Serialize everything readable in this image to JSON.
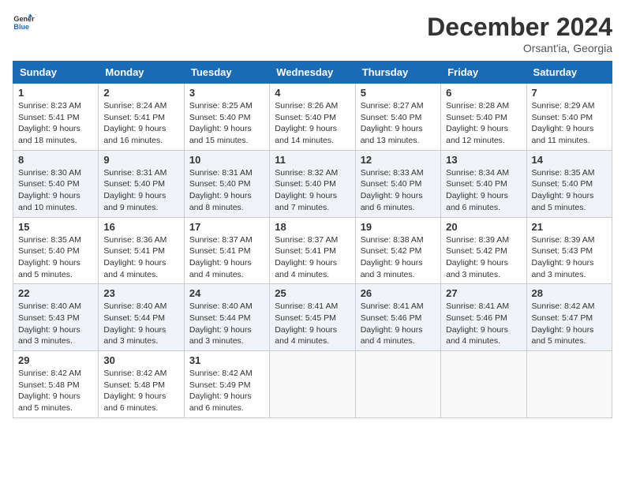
{
  "header": {
    "logo_line1": "General",
    "logo_line2": "Blue",
    "month": "December 2024",
    "location": "Orsant'ia, Georgia"
  },
  "weekdays": [
    "Sunday",
    "Monday",
    "Tuesday",
    "Wednesday",
    "Thursday",
    "Friday",
    "Saturday"
  ],
  "weeks": [
    [
      {
        "day": "1",
        "sunrise": "8:23 AM",
        "sunset": "5:41 PM",
        "daylight": "9 hours and 18 minutes."
      },
      {
        "day": "2",
        "sunrise": "8:24 AM",
        "sunset": "5:41 PM",
        "daylight": "9 hours and 16 minutes."
      },
      {
        "day": "3",
        "sunrise": "8:25 AM",
        "sunset": "5:40 PM",
        "daylight": "9 hours and 15 minutes."
      },
      {
        "day": "4",
        "sunrise": "8:26 AM",
        "sunset": "5:40 PM",
        "daylight": "9 hours and 14 minutes."
      },
      {
        "day": "5",
        "sunrise": "8:27 AM",
        "sunset": "5:40 PM",
        "daylight": "9 hours and 13 minutes."
      },
      {
        "day": "6",
        "sunrise": "8:28 AM",
        "sunset": "5:40 PM",
        "daylight": "9 hours and 12 minutes."
      },
      {
        "day": "7",
        "sunrise": "8:29 AM",
        "sunset": "5:40 PM",
        "daylight": "9 hours and 11 minutes."
      }
    ],
    [
      {
        "day": "8",
        "sunrise": "8:30 AM",
        "sunset": "5:40 PM",
        "daylight": "9 hours and 10 minutes."
      },
      {
        "day": "9",
        "sunrise": "8:31 AM",
        "sunset": "5:40 PM",
        "daylight": "9 hours and 9 minutes."
      },
      {
        "day": "10",
        "sunrise": "8:31 AM",
        "sunset": "5:40 PM",
        "daylight": "9 hours and 8 minutes."
      },
      {
        "day": "11",
        "sunrise": "8:32 AM",
        "sunset": "5:40 PM",
        "daylight": "9 hours and 7 minutes."
      },
      {
        "day": "12",
        "sunrise": "8:33 AM",
        "sunset": "5:40 PM",
        "daylight": "9 hours and 6 minutes."
      },
      {
        "day": "13",
        "sunrise": "8:34 AM",
        "sunset": "5:40 PM",
        "daylight": "9 hours and 6 minutes."
      },
      {
        "day": "14",
        "sunrise": "8:35 AM",
        "sunset": "5:40 PM",
        "daylight": "9 hours and 5 minutes."
      }
    ],
    [
      {
        "day": "15",
        "sunrise": "8:35 AM",
        "sunset": "5:40 PM",
        "daylight": "9 hours and 5 minutes."
      },
      {
        "day": "16",
        "sunrise": "8:36 AM",
        "sunset": "5:41 PM",
        "daylight": "9 hours and 4 minutes."
      },
      {
        "day": "17",
        "sunrise": "8:37 AM",
        "sunset": "5:41 PM",
        "daylight": "9 hours and 4 minutes."
      },
      {
        "day": "18",
        "sunrise": "8:37 AM",
        "sunset": "5:41 PM",
        "daylight": "9 hours and 4 minutes."
      },
      {
        "day": "19",
        "sunrise": "8:38 AM",
        "sunset": "5:42 PM",
        "daylight": "9 hours and 3 minutes."
      },
      {
        "day": "20",
        "sunrise": "8:39 AM",
        "sunset": "5:42 PM",
        "daylight": "9 hours and 3 minutes."
      },
      {
        "day": "21",
        "sunrise": "8:39 AM",
        "sunset": "5:43 PM",
        "daylight": "9 hours and 3 minutes."
      }
    ],
    [
      {
        "day": "22",
        "sunrise": "8:40 AM",
        "sunset": "5:43 PM",
        "daylight": "9 hours and 3 minutes."
      },
      {
        "day": "23",
        "sunrise": "8:40 AM",
        "sunset": "5:44 PM",
        "daylight": "9 hours and 3 minutes."
      },
      {
        "day": "24",
        "sunrise": "8:40 AM",
        "sunset": "5:44 PM",
        "daylight": "9 hours and 3 minutes."
      },
      {
        "day": "25",
        "sunrise": "8:41 AM",
        "sunset": "5:45 PM",
        "daylight": "9 hours and 4 minutes."
      },
      {
        "day": "26",
        "sunrise": "8:41 AM",
        "sunset": "5:46 PM",
        "daylight": "9 hours and 4 minutes."
      },
      {
        "day": "27",
        "sunrise": "8:41 AM",
        "sunset": "5:46 PM",
        "daylight": "9 hours and 4 minutes."
      },
      {
        "day": "28",
        "sunrise": "8:42 AM",
        "sunset": "5:47 PM",
        "daylight": "9 hours and 5 minutes."
      }
    ],
    [
      {
        "day": "29",
        "sunrise": "8:42 AM",
        "sunset": "5:48 PM",
        "daylight": "9 hours and 5 minutes."
      },
      {
        "day": "30",
        "sunrise": "8:42 AM",
        "sunset": "5:48 PM",
        "daylight": "9 hours and 6 minutes."
      },
      {
        "day": "31",
        "sunrise": "8:42 AM",
        "sunset": "5:49 PM",
        "daylight": "9 hours and 6 minutes."
      },
      null,
      null,
      null,
      null
    ]
  ],
  "labels": {
    "sunrise": "Sunrise:",
    "sunset": "Sunset:",
    "daylight": "Daylight:"
  }
}
